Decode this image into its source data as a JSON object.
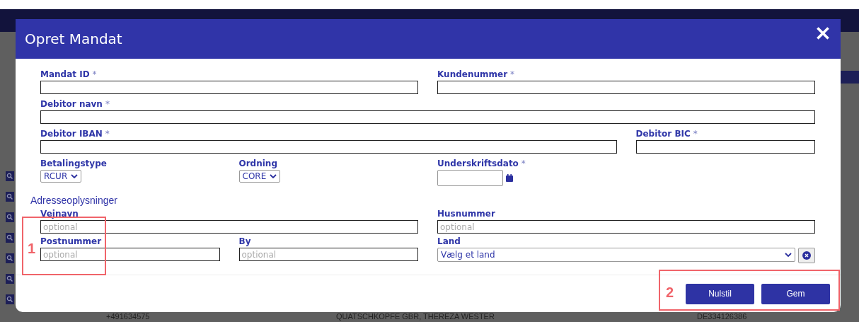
{
  "background_page": {
    "row_cells": [
      "+491634575",
      "QUATSCHKOPFE GBR, THEREZA WESTER",
      "DE334126386"
    ]
  },
  "dialog": {
    "title": "Opret Mandat",
    "fields": [
      {
        "label": "Mandat ID",
        "required": "*",
        "kind": "text"
      },
      {
        "label": "Kundenummer",
        "required": "*",
        "kind": "text"
      },
      {
        "label": "Debitor navn",
        "required": "*",
        "kind": "text"
      },
      {
        "label": "Debitor IBAN",
        "required": "*",
        "kind": "text"
      },
      {
        "label": "Debitor BIC",
        "required": "*",
        "kind": "text"
      },
      {
        "label": "Betalingstype",
        "kind": "select",
        "value": "RCUR"
      },
      {
        "label": "Ordning",
        "kind": "select",
        "value": "CORE"
      },
      {
        "label": "Underskriftsdato",
        "required": "*",
        "kind": "date"
      }
    ],
    "section_title": "Adresseoplysninger",
    "address_fields": [
      {
        "label": "Vejnavn",
        "kind": "text",
        "placeholder": "optional"
      },
      {
        "label": "Husnummer",
        "kind": "text",
        "placeholder": "optional"
      },
      {
        "label": "Postnummer",
        "kind": "text",
        "placeholder": "optional"
      },
      {
        "label": "By",
        "kind": "text",
        "placeholder": "optional"
      },
      {
        "label": "Land",
        "kind": "clearable-select",
        "value": "Vælg et land"
      }
    ],
    "buttons": [
      "Nulstil",
      "Gem"
    ]
  },
  "annotations": [
    {
      "label": "1"
    },
    {
      "label": "2"
    }
  ]
}
